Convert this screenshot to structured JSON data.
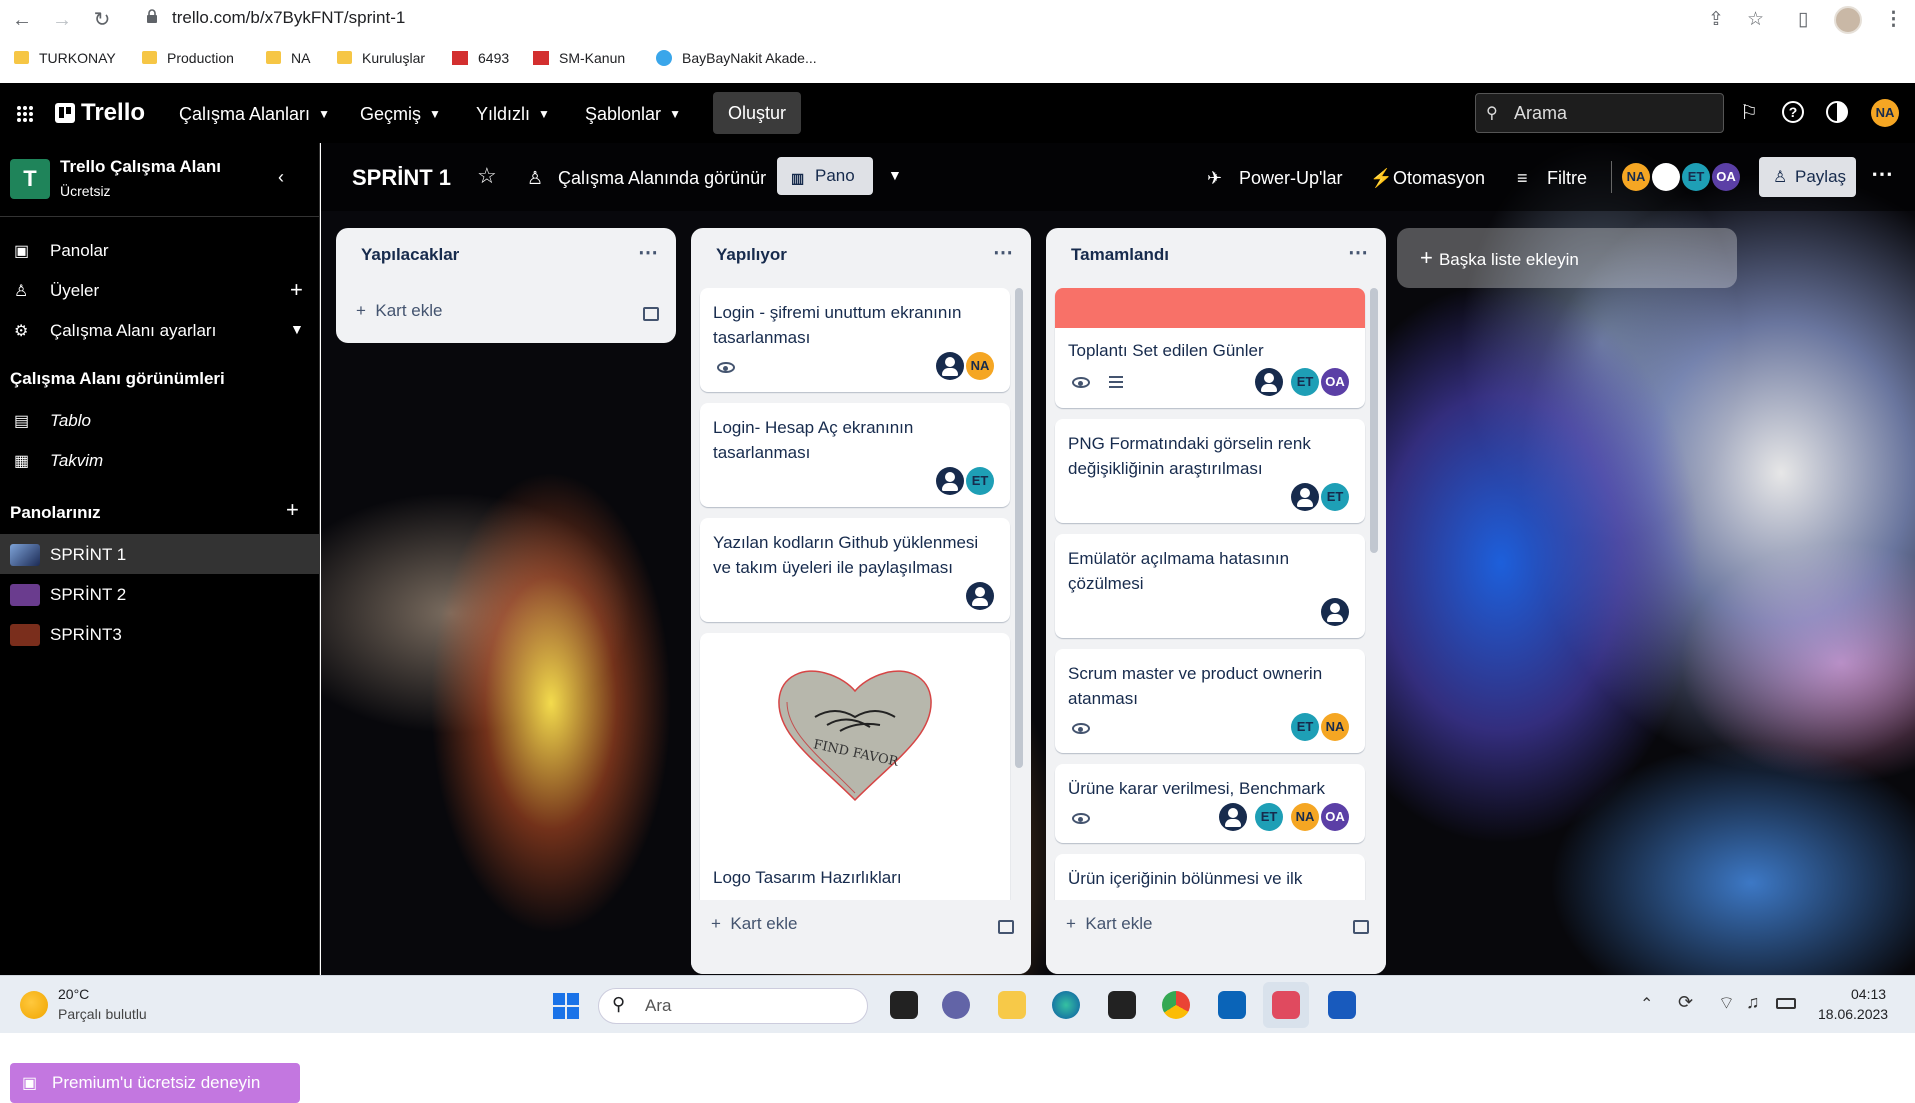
{
  "browser": {
    "url": "trello.com/b/x7BykFNT/sprint-1"
  },
  "bookmarks": [
    "TURKONAY",
    "Production",
    "NA",
    "Kuruluşlar",
    "6493",
    "SM-Kanun",
    "BayBayNakit Akade..."
  ],
  "header": {
    "logo": "Trello",
    "menus": [
      "Çalışma Alanları",
      "Geçmiş",
      "Yıldızlı",
      "Şablonlar"
    ],
    "create": "Oluştur",
    "search_placeholder": "Arama",
    "user_initials": "NA"
  },
  "sidebar": {
    "workspace_initial": "T",
    "workspace_name": "Trello Çalışma Alanı",
    "plan": "Ücretsiz",
    "items": [
      "Panolar",
      "Üyeler",
      "Çalışma Alanı ayarları"
    ],
    "views_heading": "Çalışma Alanı görünümleri",
    "views": [
      "Tablo",
      "Takvim"
    ],
    "boards_heading": "Panolarınız",
    "boards": [
      "SPRİNT 1",
      "SPRİNT 2",
      "SPRİNT3"
    ],
    "board_colors": [
      "#3b5a8a",
      "#6a3c8e",
      "#7a2e1c"
    ],
    "premium": "Premium'u ücretsiz deneyin"
  },
  "board": {
    "title": "SPRİNT 1",
    "visibility": "Çalışma Alanında görünür",
    "view": "Pano",
    "powerups": "Power-Up'lar",
    "automation": "Otomasyon",
    "filter": "Filtre",
    "share": "Paylaş",
    "members": [
      "NA",
      "ET",
      "OA"
    ]
  },
  "lists": [
    {
      "title": "Yapılacaklar",
      "add_card": "Kart ekle"
    },
    {
      "title": "Yapılıyor",
      "add_card": "Kart ekle",
      "cards": [
        {
          "title": "Login - şifremi unuttum ekranının tasarlanması",
          "members": [
            "NA"
          ]
        },
        {
          "title": "Login- Hesap Aç ekranının tasarlanması",
          "members": [
            "ET"
          ]
        },
        {
          "title": "Yazılan kodların Github yüklenmesi ve takım üyeleri ile paylaşılması",
          "members": []
        },
        {
          "title": "Logo Tasarım Hazırlıkları",
          "logo_text": "FIND FAVOR"
        }
      ]
    },
    {
      "title": "Tamamlandı",
      "add_card": "Kart ekle",
      "cards": [
        {
          "title": "Toplantı Set edilen Günler",
          "members": [
            "ET",
            "OA"
          ],
          "cover": "#f87168"
        },
        {
          "title": "PNG Formatındaki görselin renk değişikliğinin araştırılması",
          "members": [
            "ET"
          ]
        },
        {
          "title": "Emülatör açılmama hatasının çözülmesi",
          "members": []
        },
        {
          "title": "Scrum master ve product ownerin atanması",
          "members": [
            "ET",
            "NA"
          ]
        },
        {
          "title": "Ürüne karar verilmesi, Benchmark",
          "members": [
            "ET",
            "NA",
            "OA"
          ]
        },
        {
          "title": "Ürün içeriğinin bölünmesi ve ilk"
        }
      ]
    }
  ],
  "add_list": "Başka liste ekleyin",
  "taskbar": {
    "temp": "20°C",
    "weather": "Parçalı bulutlu",
    "search": "Ara",
    "time": "04:13",
    "date": "18.06.2023"
  }
}
